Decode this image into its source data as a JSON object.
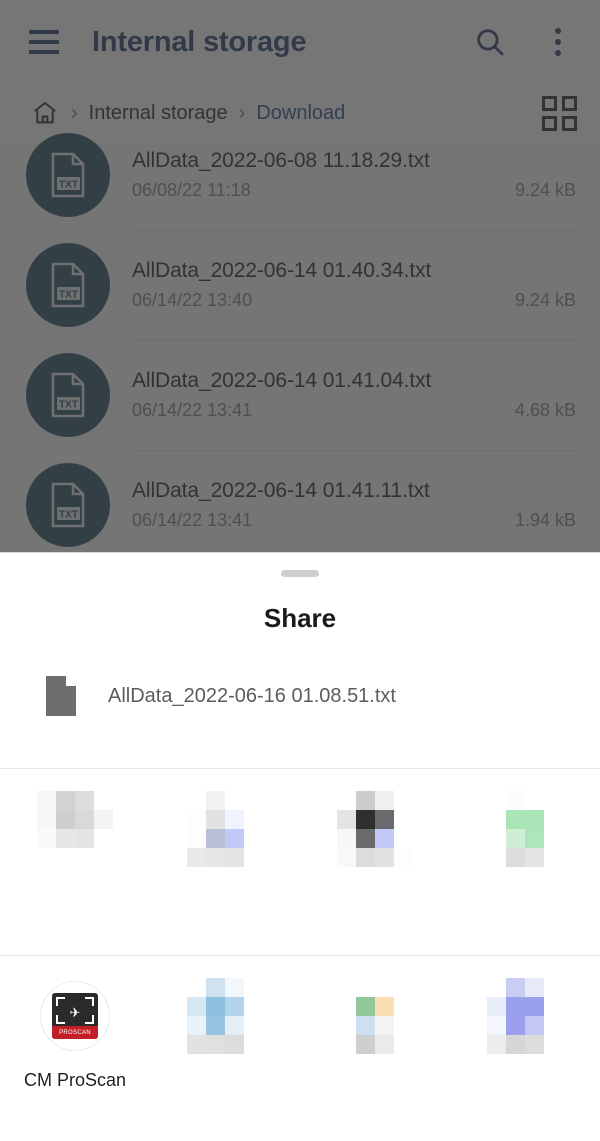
{
  "app": {
    "title": "Internal storage",
    "menu_icon": "hamburger-icon",
    "search_icon": "search-icon",
    "overflow_icon": "more-vertical-icon"
  },
  "breadcrumb": {
    "home_icon": "home-icon",
    "separator": "›",
    "items": [
      {
        "label": "Internal storage",
        "active": false
      },
      {
        "label": "Download",
        "active": true
      }
    ],
    "view_toggle_icon": "grid-view-icon"
  },
  "file_list": {
    "file_type_badge": "txt-file-icon",
    "rows": [
      {
        "name": "AllData_2022-06-08 11.18.29.txt",
        "date": "06/08/22 11:18",
        "size": "9.24 kB"
      },
      {
        "name": "AllData_2022-06-14 01.40.34.txt",
        "date": "06/14/22 13:40",
        "size": "9.24 kB"
      },
      {
        "name": "AllData_2022-06-14 01.41.04.txt",
        "date": "06/14/22 13:41",
        "size": "4.68 kB"
      },
      {
        "name": "AllData_2022-06-14 01.41.11.txt",
        "date": "06/14/22 13:41",
        "size": "1.94 kB"
      }
    ]
  },
  "share_sheet": {
    "title": "Share",
    "drag_handle": "drag-handle",
    "file_icon": "document-icon",
    "file_name": "AllData_2022-06-16 01.08.51.txt",
    "rows": [
      {
        "targets": [
          {
            "label": "",
            "icon": "redacted-app-icon",
            "redacted": true
          },
          {
            "label": "",
            "icon": "redacted-app-icon",
            "redacted": true
          },
          {
            "label": "",
            "icon": "redacted-app-icon",
            "redacted": true
          },
          {
            "label": "",
            "icon": "redacted-app-icon",
            "redacted": true
          }
        ]
      },
      {
        "targets": [
          {
            "label": "CM ProScan",
            "icon": "cm-proscan-icon",
            "redacted": false,
            "badge_text": "PROSCAN"
          },
          {
            "label": "",
            "icon": "redacted-app-icon",
            "redacted": true
          },
          {
            "label": "",
            "icon": "redacted-app-icon",
            "redacted": true
          },
          {
            "label": "",
            "icon": "redacted-app-icon",
            "redacted": true
          }
        ]
      }
    ]
  },
  "colors": {
    "accent_navy": "#1d3461",
    "breadcrumb_active": "#23467f",
    "txt_badge": "#1b4a5e",
    "scrim": "rgba(60,60,60,0.70)",
    "sheet_background": "#ffffff",
    "proscan_band": "#c21f26"
  },
  "mosaics": {
    "r0c0": [
      "#f7f7f7",
      "#d2d2d2",
      "#dcdcdc",
      "#ffffff",
      "#f7f7f7",
      "#cfcfcf",
      "#d9d9d9",
      "#f4f4f4",
      "#fafafa",
      "#e6e6e6",
      "#e4e4e4",
      "#ffffff",
      "#ffffff",
      "#ffffff",
      "#ffffff",
      "#ffffff"
    ],
    "r0c1": [
      "#ffffff",
      "#f2f2f2",
      "#ffffff",
      "#ffffff",
      "#fbfdff",
      "#e2e2e2",
      "#eef3fd",
      "#ffffff",
      "#fdfdfd",
      "#b9c0d6",
      "#c3c9f7",
      "#ffffff",
      "#e9e9e9",
      "#e6e6e6",
      "#e4e4e4",
      "#ffffff"
    ],
    "r0c2": [
      "#ffffff",
      "#cdcdcd",
      "#efefef",
      "#ffffff",
      "#e4e4e4",
      "#2f2f2f",
      "#6a6a6e",
      "#ffffff",
      "#f7f7f7",
      "#6b6b6d",
      "#c3c9f7",
      "#ffffff",
      "#f8f8f8",
      "#dcdcdc",
      "#e2e2e2",
      "#fdfdfd"
    ],
    "r0c3": [
      "#ffffff",
      "#fcfcfc",
      "#ffffff",
      "#ffffff",
      "#ffffff",
      "#a9e5b6",
      "#a9e5b6",
      "#ffffff",
      "#ffffff",
      "#cdf0d4",
      "#aee6ba",
      "#ffffff",
      "#ffffff",
      "#dcdcdc",
      "#e4e4e4",
      "#ffffff"
    ],
    "r1c1": [
      "#ffffff",
      "#cfe2f2",
      "#f2f7fc",
      "#ffffff",
      "#d7e8f5",
      "#8fc0e0",
      "#b3d4ea",
      "#ffffff",
      "#eaf2f9",
      "#96c4e2",
      "#e4eef7",
      "#ffffff",
      "#e2e2e2",
      "#e0e0e0",
      "#dcdcdc",
      "#ffffff"
    ],
    "r1c2": [
      "#ffffff",
      "#ffffff",
      "#ffffff",
      "#ffffff",
      "#ffffff",
      "#91c79b",
      "#fadfb4",
      "#ffffff",
      "#ffffff",
      "#cce0f1",
      "#f4f4f2",
      "#ffffff",
      "#ffffff",
      "#cfcfcf",
      "#eaeaea",
      "#ffffff"
    ],
    "r1c3": [
      "#ffffff",
      "#c9cdf3",
      "#e7eaf9",
      "#ffffff",
      "#eaeefb",
      "#9aa0ec",
      "#9aa0ec",
      "#ffffff",
      "#f4f5fd",
      "#9aa0ec",
      "#c3c7f2",
      "#ffffff",
      "#ececec",
      "#d6d6d6",
      "#dcdcdc",
      "#ffffff"
    ]
  }
}
